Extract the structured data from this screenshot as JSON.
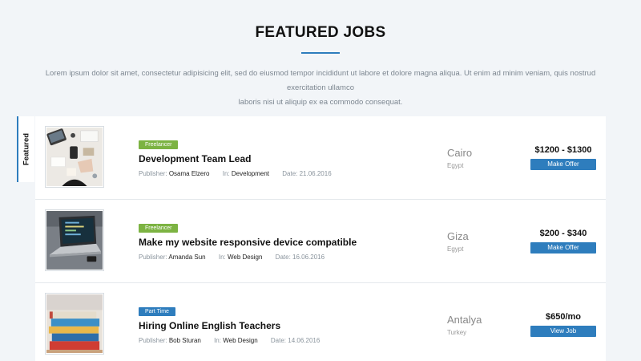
{
  "header": {
    "title": "FEATURED JOBS",
    "intro_line1": "Lorem ipsum dolor sit amet, consectetur adipisicing elit, sed do eiusmod tempor incididunt ut labore et dolore magna aliqua. Ut enim ad minim veniam, quis nostrud exercitation ullamco",
    "intro_line2": "laboris nisi ut aliquip ex ea commodo consequat."
  },
  "featured_tab": {
    "label": "Featured"
  },
  "jobs": [
    {
      "badge": "Freelancer",
      "badge_color": "#7cb342",
      "title": "Development Team Lead",
      "publisher_label": "Publisher:",
      "publisher": "Osama Elzero",
      "in_label": "In:",
      "category": "Development",
      "date_label": "Date:",
      "date": "21.06.2016",
      "city": "Cairo",
      "country": "Egypt",
      "price": "$1200 - $1300",
      "action": "Make Offer"
    },
    {
      "badge": "Freelancer",
      "badge_color": "#7cb342",
      "title": "Make my website responsive device compatible",
      "publisher_label": "Publisher:",
      "publisher": "Amanda Sun",
      "in_label": "In:",
      "category": "Web Design",
      "date_label": "Date:",
      "date": "16.06.2016",
      "city": "Giza",
      "country": "Egypt",
      "price": "$200 - $340",
      "action": "Make Offer"
    },
    {
      "badge": "Part Time",
      "badge_color": "#2e7dbd",
      "title": "Hiring Online English Teachers",
      "publisher_label": "Publisher:",
      "publisher": "Bob Sturan",
      "in_label": "In:",
      "category": "Web Design",
      "date_label": "Date:",
      "date": "14.06.2016",
      "city": "Antalya",
      "country": "Turkey",
      "price": "$650/mo",
      "action": "View Job"
    }
  ],
  "colors": {
    "accent": "#2e7dbd",
    "freelancer_badge": "#7cb342",
    "background": "#f2f5f8"
  }
}
